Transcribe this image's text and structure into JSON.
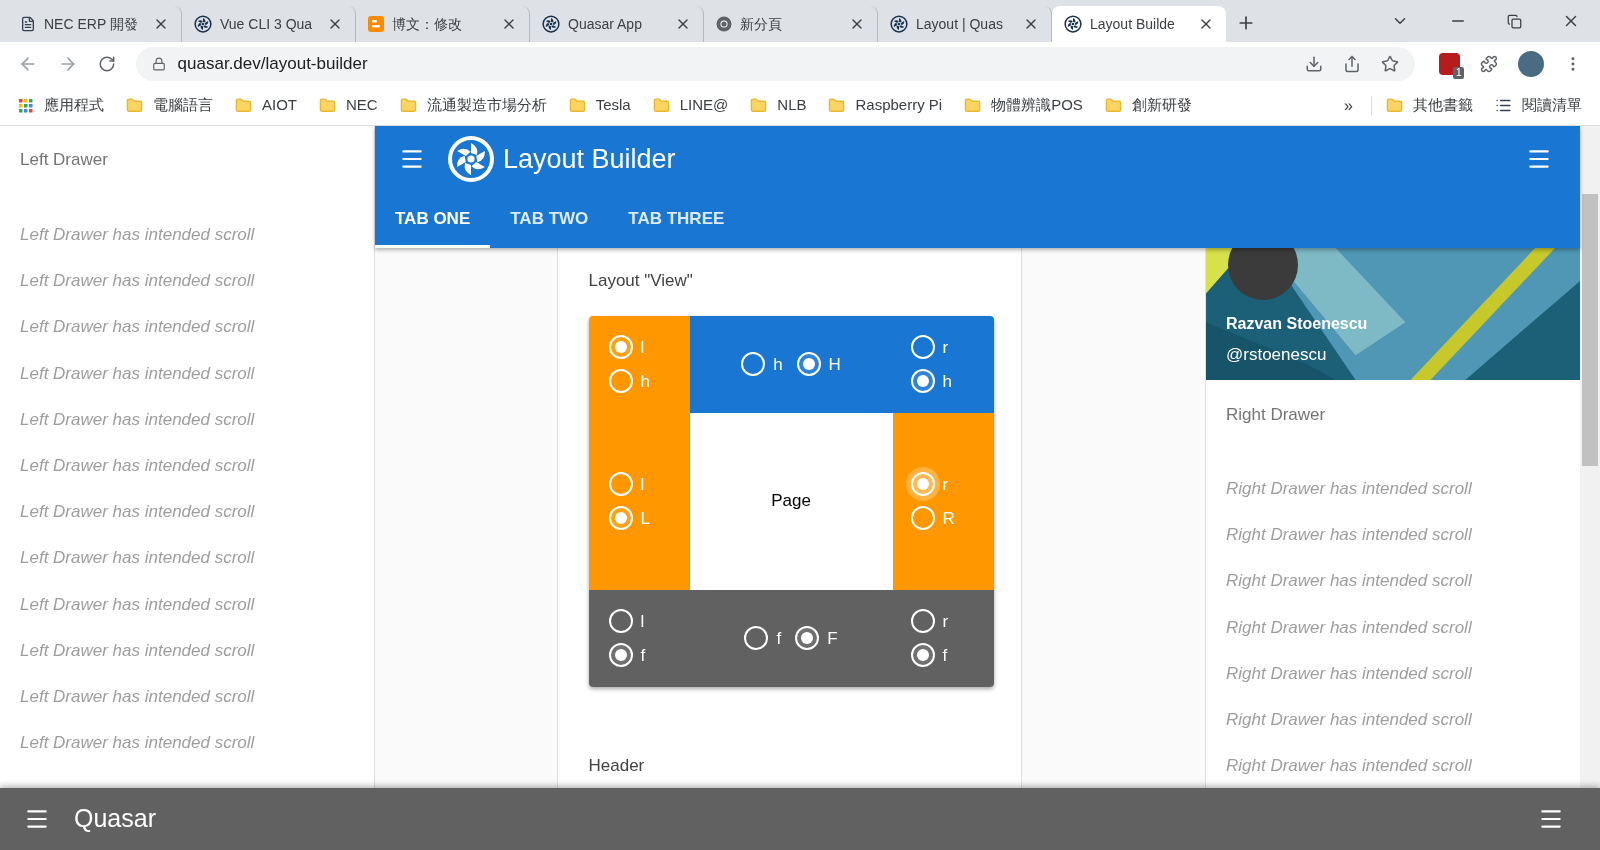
{
  "browser": {
    "tabs": [
      {
        "title": "NEC ERP 開發",
        "kind": "document",
        "selected": false
      },
      {
        "title": "Vue CLI 3 Qua",
        "kind": "quasar",
        "selected": false
      },
      {
        "title": "博文：修改",
        "kind": "blogger",
        "selected": false
      },
      {
        "title": "Quasar App",
        "kind": "quasar",
        "selected": false
      },
      {
        "title": "新分頁",
        "kind": "chrome",
        "selected": false
      },
      {
        "title": "Layout | Quas",
        "kind": "quasar",
        "selected": false
      },
      {
        "title": "Layout Builde",
        "kind": "quasar",
        "selected": true
      }
    ],
    "address": "quasar.dev/layout-builder",
    "extension_badge": "1",
    "bookmarks": [
      {
        "label": "應用程式",
        "kind": "apps"
      },
      {
        "label": "電腦語言",
        "kind": "folder"
      },
      {
        "label": "AIOT",
        "kind": "folder"
      },
      {
        "label": "NEC",
        "kind": "folder"
      },
      {
        "label": "流通製造市場分析",
        "kind": "folder"
      },
      {
        "label": "Tesla",
        "kind": "folder"
      },
      {
        "label": "LINE@",
        "kind": "folder"
      },
      {
        "label": "NLB",
        "kind": "folder"
      },
      {
        "label": "Raspberry Pi",
        "kind": "folder"
      },
      {
        "label": "物體辨識POS",
        "kind": "folder"
      },
      {
        "label": "創新研發",
        "kind": "folder"
      }
    ],
    "bookmarks_overflow": "»",
    "bookmarks_right": [
      {
        "label": "其他書籤",
        "kind": "folder"
      },
      {
        "label": "閱讀清單",
        "kind": "reading"
      }
    ]
  },
  "left_drawer": {
    "title": "Left Drawer",
    "items": [
      "Left Drawer has intended scroll",
      "Left Drawer has intended scroll",
      "Left Drawer has intended scroll",
      "Left Drawer has intended scroll",
      "Left Drawer has intended scroll",
      "Left Drawer has intended scroll",
      "Left Drawer has intended scroll",
      "Left Drawer has intended scroll",
      "Left Drawer has intended scroll",
      "Left Drawer has intended scroll",
      "Left Drawer has intended scroll",
      "Left Drawer has intended scroll"
    ]
  },
  "header": {
    "title": "Layout Builder",
    "tabs": [
      {
        "label": "TAB ONE",
        "selected": true
      },
      {
        "label": "TAB TWO",
        "selected": false
      },
      {
        "label": "TAB THREE",
        "selected": false
      }
    ]
  },
  "main": {
    "section_title": "Layout \"View\"",
    "page_label": "Page",
    "next_section": "Header",
    "layout_view": {
      "header": [
        [
          {
            "label": "l",
            "selected": true
          },
          {
            "label": "h",
            "selected": false
          }
        ],
        [
          {
            "label": "h",
            "selected": false
          },
          {
            "label": "H",
            "selected": true
          }
        ],
        [
          {
            "label": "r",
            "selected": false
          },
          {
            "label": "h",
            "selected": true
          }
        ]
      ],
      "middle": [
        [
          {
            "label": "l",
            "selected": false
          },
          {
            "label": "L",
            "selected": true
          }
        ],
        [
          {
            "label": "r",
            "selected": true
          },
          {
            "label": "R",
            "selected": false
          }
        ]
      ],
      "footer": [
        [
          {
            "label": "l",
            "selected": false
          },
          {
            "label": "f",
            "selected": true
          }
        ],
        [
          {
            "label": "f",
            "selected": false
          },
          {
            "label": "F",
            "selected": true
          }
        ],
        [
          {
            "label": "r",
            "selected": false
          },
          {
            "label": "f",
            "selected": true
          }
        ]
      ]
    }
  },
  "right_drawer": {
    "name": "Razvan Stoenescu",
    "handle": "@rstoenescu",
    "title": "Right Drawer",
    "items": [
      "Right Drawer has intended scroll",
      "Right Drawer has intended scroll",
      "Right Drawer has intended scroll",
      "Right Drawer has intended scroll",
      "Right Drawer has intended scroll",
      "Right Drawer has intended scroll",
      "Right Drawer has intended scroll"
    ]
  },
  "footer": {
    "title": "Quasar"
  }
}
